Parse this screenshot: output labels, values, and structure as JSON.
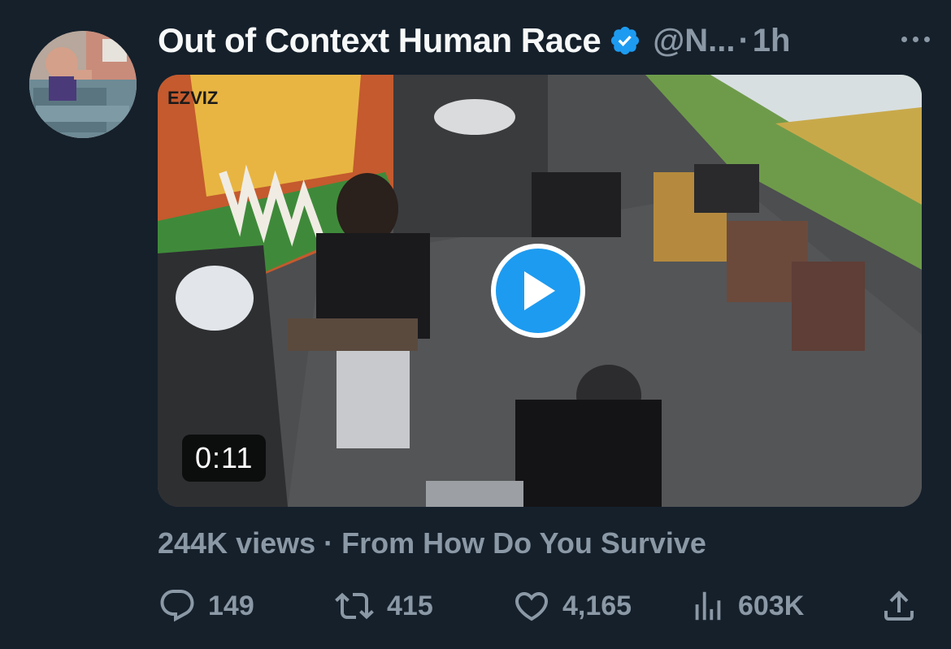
{
  "tweet": {
    "author": {
      "display_name": "Out of Context Human Race",
      "handle": "@N...",
      "separator": "·",
      "timestamp": "1h",
      "verified": true
    },
    "media": {
      "type": "video",
      "duration": "0:11",
      "watermark": "EZVIZ"
    },
    "meta": {
      "views": "244K views",
      "separator": "·",
      "source": "From How Do You Survive"
    },
    "actions": {
      "replies": "149",
      "retweets": "415",
      "likes": "4,165",
      "views": "603K"
    }
  },
  "colors": {
    "background": "#15202b",
    "primary_text": "#f7f9f9",
    "secondary_text": "#8b98a5",
    "accent": "#1d9bf0"
  },
  "icons": [
    "more-icon",
    "verified-badge-icon",
    "play-icon",
    "reply-icon",
    "retweet-icon",
    "like-icon",
    "views-icon",
    "share-icon"
  ]
}
